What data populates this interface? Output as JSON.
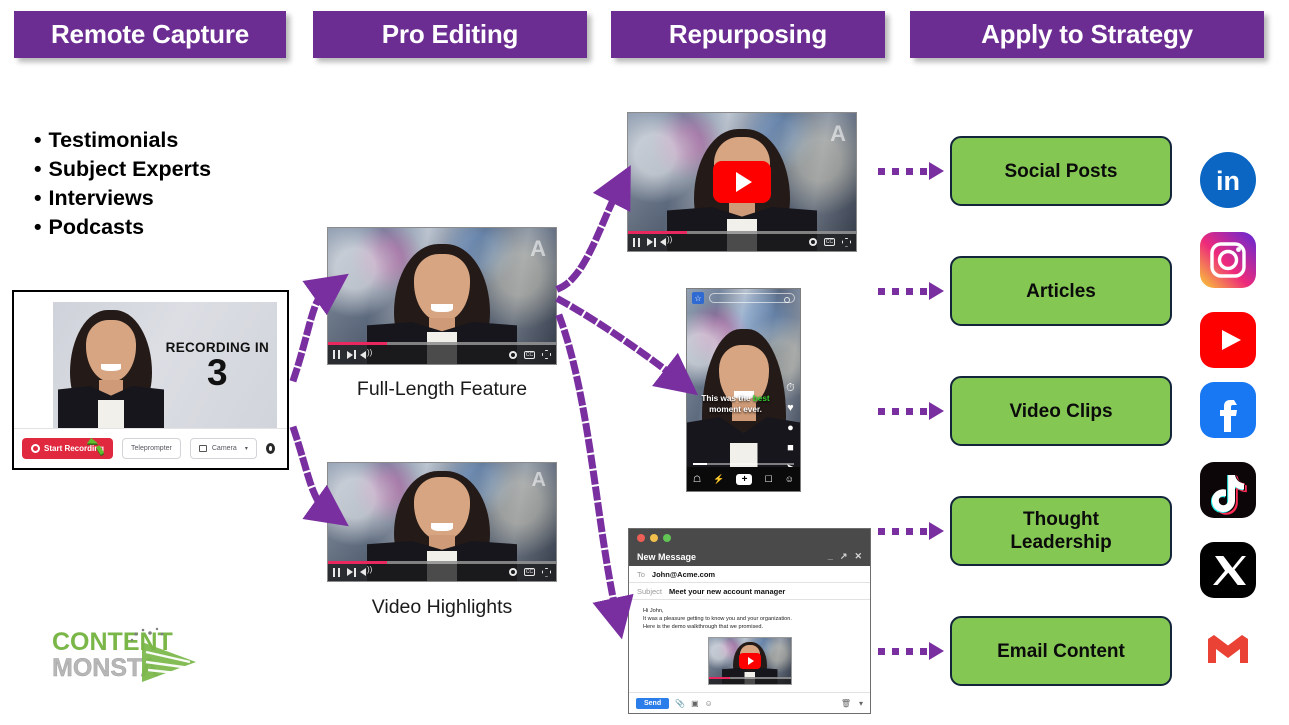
{
  "columns": [
    {
      "title": "Remote Capture"
    },
    {
      "title": "Pro Editing"
    },
    {
      "title": "Repurposing"
    },
    {
      "title": "Apply to Strategy"
    }
  ],
  "capture": {
    "bullets": [
      "Testimonials",
      "Subject Experts",
      "Interviews",
      "Podcasts"
    ],
    "recorder": {
      "countdown_label": "RECORDING IN",
      "countdown_value": "3",
      "record_button": "Start Recording",
      "teleprompter_button": "Teleprompter",
      "camera_select": "Camera",
      "settings_icon": "gear-icon",
      "cursor_icon": "cursor-pointer-icon"
    }
  },
  "editing": {
    "videos": [
      {
        "caption": "Full-Length Feature",
        "watermark": "A",
        "progress_pct": 26
      },
      {
        "caption": "Video Highlights",
        "watermark": "A",
        "progress_pct": 26
      }
    ],
    "controls": {
      "pause": "pause-icon",
      "next": "next-track-icon",
      "volume": "volume-icon",
      "settings": "gear-icon",
      "captions": "closed-captions-icon",
      "fullscreen": "fullscreen-icon",
      "cc_text": "CC"
    }
  },
  "repurposing": {
    "youtube_video": {
      "watermark": "A",
      "progress_pct": 26,
      "play_overlay": "youtube-play-icon"
    },
    "phone": {
      "app_logo": "social-app-logo",
      "search_placeholder": "",
      "caption_prefix": "This was the ",
      "caption_highlight": "best",
      "caption_suffix": " moment ever.",
      "rail_icons": [
        "clock-icon",
        "heart-icon",
        "comment-icon",
        "bookmark-icon",
        "share-icon"
      ],
      "nav_icons": [
        "home-icon",
        "flash-icon",
        "create-icon",
        "inbox-icon",
        "profile-icon"
      ],
      "nav_create_glyph": "+",
      "progress_pct": 14
    },
    "email": {
      "window_title": "New Message",
      "window_buttons": [
        "minimize",
        "expand",
        "close"
      ],
      "to_label": "To",
      "to_value": "John@Acme.com",
      "subject_label": "Subject",
      "subject_value": "Meet your new account manager",
      "body_lines": [
        "Hi John,",
        "It was a pleasure getting to know you and your organization.",
        "Here is the demo walkthrough that we promised."
      ],
      "send_button": "Send",
      "toolbar_icons": [
        "attachment-icon",
        "image-icon",
        "emoji-icon"
      ],
      "trash_icon": "trash-icon",
      "more_icon": "more-options-icon"
    }
  },
  "strategy": {
    "outcomes": [
      "Social Posts",
      "Articles",
      "Video Clips",
      "Thought\nLeadership",
      "Email Content"
    ],
    "social_icons": [
      {
        "name": "linkedin-icon",
        "label": "LinkedIn",
        "color": "#0a66c2"
      },
      {
        "name": "instagram-icon",
        "label": "Instagram",
        "color": "#d62976"
      },
      {
        "name": "youtube-icon",
        "label": "YouTube",
        "color": "#ff0000"
      },
      {
        "name": "facebook-icon",
        "label": "Facebook",
        "color": "#1877f2"
      },
      {
        "name": "tiktok-icon",
        "label": "TikTok",
        "color": "#010101"
      },
      {
        "name": "x-icon",
        "label": "X",
        "color": "#000000"
      },
      {
        "name": "gmail-icon",
        "label": "Gmail",
        "color": "#ea4335"
      }
    ]
  },
  "brand": {
    "logo_line1": "CONTENT",
    "logo_line2": "MONSTA",
    "green": "#7ab648",
    "grey": "#b7b7b7",
    "purple": "#6c2d92",
    "box_green": "#84c753"
  }
}
